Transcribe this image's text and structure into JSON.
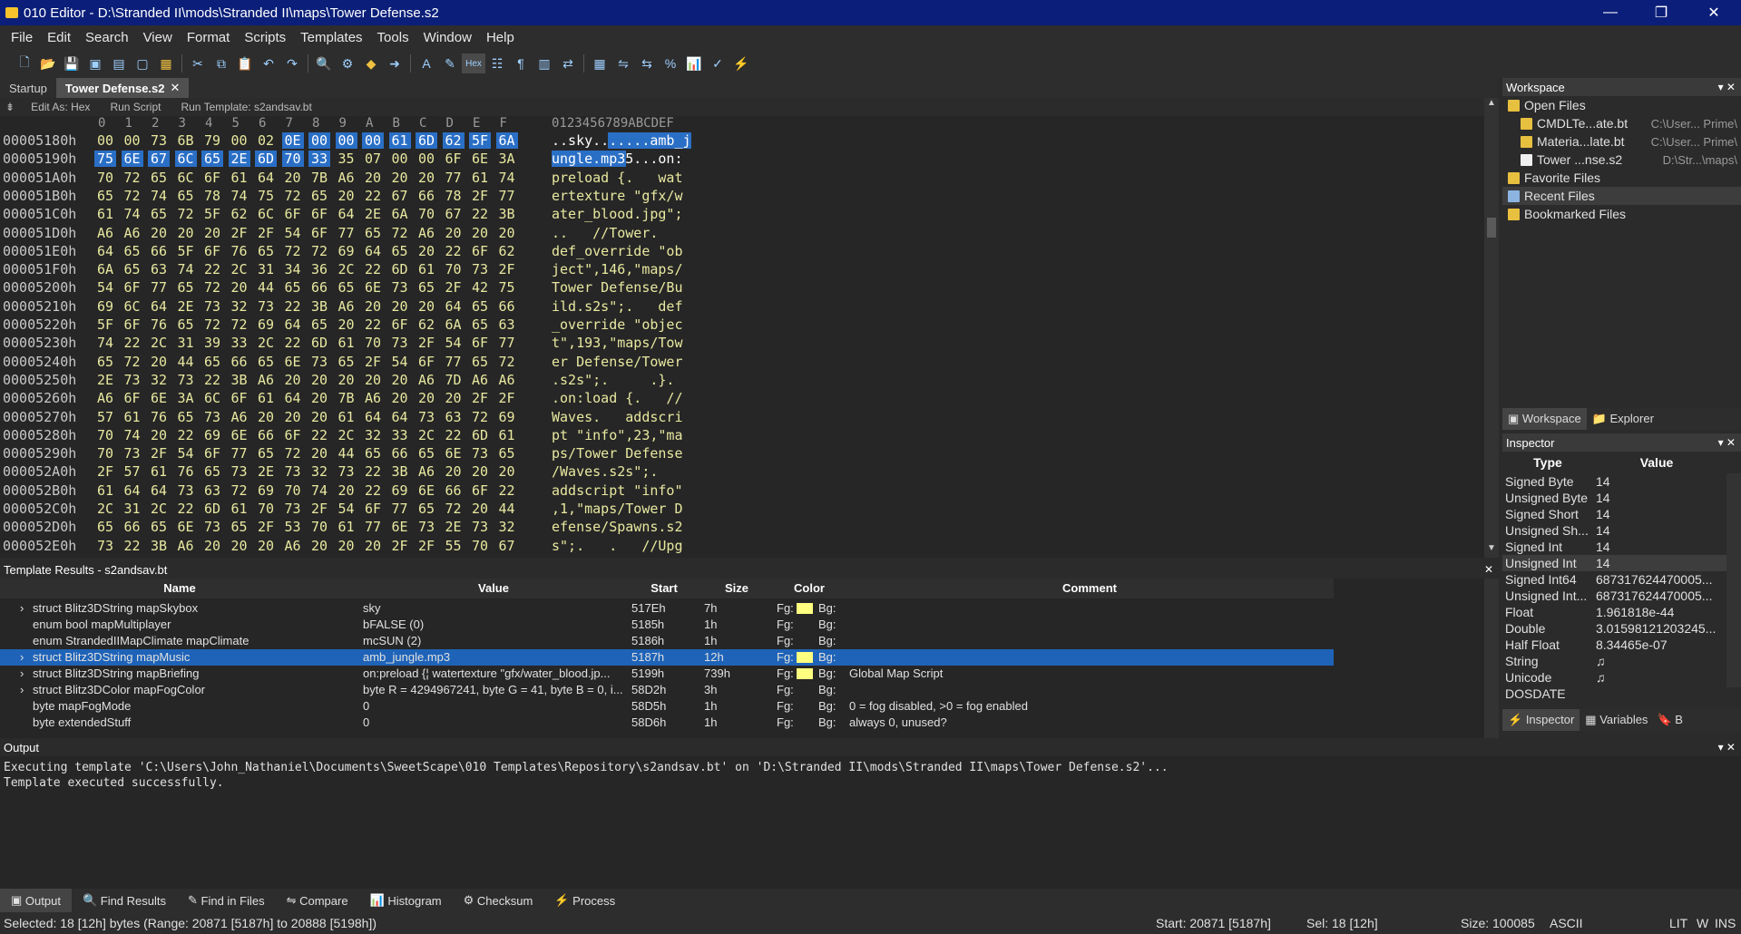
{
  "window": {
    "title": "010 Editor - D:\\Stranded II\\mods\\Stranded II\\maps\\Tower Defense.s2",
    "minimize": "—",
    "restore": "❐",
    "close": "✕"
  },
  "menu": [
    "File",
    "Edit",
    "Search",
    "View",
    "Format",
    "Scripts",
    "Templates",
    "Tools",
    "Window",
    "Help"
  ],
  "toolbar": {
    "hex_label": "Hex"
  },
  "tabs": {
    "startup": "Startup",
    "active": "Tower Defense.s2",
    "close": "✕"
  },
  "editbar": {
    "edit_as": "Edit As: Hex",
    "run_script": "Run Script",
    "run_template": "Run Template: s2andsav.bt"
  },
  "hex": {
    "col_headers": [
      "0",
      "1",
      "2",
      "3",
      "4",
      "5",
      "6",
      "7",
      "8",
      "9",
      "A",
      "B",
      "C",
      "D",
      "E",
      "F"
    ],
    "ascii_header": "0123456789ABCDEF",
    "rows": [
      {
        "addr": "00005180h",
        "bytes": [
          "00",
          "00",
          "73",
          "6B",
          "79",
          "00",
          "02",
          "0E",
          "00",
          "00",
          "00",
          "61",
          "6D",
          "62",
          "5F",
          "6A"
        ],
        "ascii": "..sky.......amb_j"
      },
      {
        "addr": "00005190h",
        "bytes": [
          "75",
          "6E",
          "67",
          "6C",
          "65",
          "2E",
          "6D",
          "70",
          "33",
          "35",
          "07",
          "00",
          "00",
          "6F",
          "6E",
          "3A"
        ],
        "ascii": "ungle.mp35...on:"
      },
      {
        "addr": "000051A0h",
        "bytes": [
          "70",
          "72",
          "65",
          "6C",
          "6F",
          "61",
          "64",
          "20",
          "7B",
          "A6",
          "20",
          "20",
          "20",
          "77",
          "61",
          "74"
        ],
        "ascii": "preload {.   wat"
      },
      {
        "addr": "000051B0h",
        "bytes": [
          "65",
          "72",
          "74",
          "65",
          "78",
          "74",
          "75",
          "72",
          "65",
          "20",
          "22",
          "67",
          "66",
          "78",
          "2F",
          "77"
        ],
        "ascii": "ertexture \"gfx/w"
      },
      {
        "addr": "000051C0h",
        "bytes": [
          "61",
          "74",
          "65",
          "72",
          "5F",
          "62",
          "6C",
          "6F",
          "6F",
          "64",
          "2E",
          "6A",
          "70",
          "67",
          "22",
          "3B"
        ],
        "ascii": "ater_blood.jpg\";"
      },
      {
        "addr": "000051D0h",
        "bytes": [
          "A6",
          "A6",
          "20",
          "20",
          "20",
          "2F",
          "2F",
          "54",
          "6F",
          "77",
          "65",
          "72",
          "A6",
          "20",
          "20",
          "20"
        ],
        "ascii": "..   //Tower.   "
      },
      {
        "addr": "000051E0h",
        "bytes": [
          "64",
          "65",
          "66",
          "5F",
          "6F",
          "76",
          "65",
          "72",
          "72",
          "69",
          "64",
          "65",
          "20",
          "22",
          "6F",
          "62"
        ],
        "ascii": "def_override \"ob"
      },
      {
        "addr": "000051F0h",
        "bytes": [
          "6A",
          "65",
          "63",
          "74",
          "22",
          "2C",
          "31",
          "34",
          "36",
          "2C",
          "22",
          "6D",
          "61",
          "70",
          "73",
          "2F"
        ],
        "ascii": "ject\",146,\"maps/"
      },
      {
        "addr": "00005200h",
        "bytes": [
          "54",
          "6F",
          "77",
          "65",
          "72",
          "20",
          "44",
          "65",
          "66",
          "65",
          "6E",
          "73",
          "65",
          "2F",
          "42",
          "75"
        ],
        "ascii": "Tower Defense/Bu"
      },
      {
        "addr": "00005210h",
        "bytes": [
          "69",
          "6C",
          "64",
          "2E",
          "73",
          "32",
          "73",
          "22",
          "3B",
          "A6",
          "20",
          "20",
          "20",
          "64",
          "65",
          "66"
        ],
        "ascii": "ild.s2s\";.   def"
      },
      {
        "addr": "00005220h",
        "bytes": [
          "5F",
          "6F",
          "76",
          "65",
          "72",
          "72",
          "69",
          "64",
          "65",
          "20",
          "22",
          "6F",
          "62",
          "6A",
          "65",
          "63"
        ],
        "ascii": "_override \"objec"
      },
      {
        "addr": "00005230h",
        "bytes": [
          "74",
          "22",
          "2C",
          "31",
          "39",
          "33",
          "2C",
          "22",
          "6D",
          "61",
          "70",
          "73",
          "2F",
          "54",
          "6F",
          "77"
        ],
        "ascii": "t\",193,\"maps/Tow"
      },
      {
        "addr": "00005240h",
        "bytes": [
          "65",
          "72",
          "20",
          "44",
          "65",
          "66",
          "65",
          "6E",
          "73",
          "65",
          "2F",
          "54",
          "6F",
          "77",
          "65",
          "72"
        ],
        "ascii": "er Defense/Tower"
      },
      {
        "addr": "00005250h",
        "bytes": [
          "2E",
          "73",
          "32",
          "73",
          "22",
          "3B",
          "A6",
          "20",
          "20",
          "20",
          "20",
          "20",
          "A6",
          "7D",
          "A6",
          "A6"
        ],
        "ascii": ".s2s\";.     .}."
      },
      {
        "addr": "00005260h",
        "bytes": [
          "A6",
          "6F",
          "6E",
          "3A",
          "6C",
          "6F",
          "61",
          "64",
          "20",
          "7B",
          "A6",
          "20",
          "20",
          "20",
          "2F",
          "2F"
        ],
        "ascii": ".on:load {.   //"
      },
      {
        "addr": "00005270h",
        "bytes": [
          "57",
          "61",
          "76",
          "65",
          "73",
          "A6",
          "20",
          "20",
          "20",
          "61",
          "64",
          "64",
          "73",
          "63",
          "72",
          "69"
        ],
        "ascii": "Waves.   addscri"
      },
      {
        "addr": "00005280h",
        "bytes": [
          "70",
          "74",
          "20",
          "22",
          "69",
          "6E",
          "66",
          "6F",
          "22",
          "2C",
          "32",
          "33",
          "2C",
          "22",
          "6D",
          "61"
        ],
        "ascii": "pt \"info\",23,\"ma"
      },
      {
        "addr": "00005290h",
        "bytes": [
          "70",
          "73",
          "2F",
          "54",
          "6F",
          "77",
          "65",
          "72",
          "20",
          "44",
          "65",
          "66",
          "65",
          "6E",
          "73",
          "65"
        ],
        "ascii": "ps/Tower Defense"
      },
      {
        "addr": "000052A0h",
        "bytes": [
          "2F",
          "57",
          "61",
          "76",
          "65",
          "73",
          "2E",
          "73",
          "32",
          "73",
          "22",
          "3B",
          "A6",
          "20",
          "20",
          "20"
        ],
        "ascii": "/Waves.s2s\";.   "
      },
      {
        "addr": "000052B0h",
        "bytes": [
          "61",
          "64",
          "64",
          "73",
          "63",
          "72",
          "69",
          "70",
          "74",
          "20",
          "22",
          "69",
          "6E",
          "66",
          "6F",
          "22"
        ],
        "ascii": "addscript \"info\""
      },
      {
        "addr": "000052C0h",
        "bytes": [
          "2C",
          "31",
          "2C",
          "22",
          "6D",
          "61",
          "70",
          "73",
          "2F",
          "54",
          "6F",
          "77",
          "65",
          "72",
          "20",
          "44"
        ],
        "ascii": ",1,\"maps/Tower D"
      },
      {
        "addr": "000052D0h",
        "bytes": [
          "65",
          "66",
          "65",
          "6E",
          "73",
          "65",
          "2F",
          "53",
          "70",
          "61",
          "77",
          "6E",
          "73",
          "2E",
          "73",
          "32"
        ],
        "ascii": "efense/Spawns.s2"
      },
      {
        "addr": "000052E0h",
        "bytes": [
          "73",
          "22",
          "3B",
          "A6",
          "20",
          "20",
          "20",
          "A6",
          "20",
          "20",
          "20",
          "2F",
          "2F",
          "55",
          "70",
          "67"
        ],
        "ascii": "s\";.   .   //Upg"
      },
      {
        "addr": "000052F0h",
        "bytes": [
          "72",
          "61",
          "64",
          "65",
          "20",
          "48",
          "61",
          "6E",
          "64",
          "6C",
          "65",
          "72",
          "A6",
          "20",
          "20",
          "20"
        ],
        "ascii": "rade Handler.   "
      }
    ]
  },
  "workspace": {
    "title": "Workspace",
    "open_files": "Open Files",
    "files": [
      {
        "name": "CMDLTe...ate.bt",
        "path": "C:\\User... Prime\\"
      },
      {
        "name": "Materia...late.bt",
        "path": "C:\\User... Prime\\"
      },
      {
        "name": "Tower ...nse.s2",
        "path": "D:\\Str...\\maps\\"
      }
    ],
    "favorite": "Favorite Files",
    "recent": "Recent Files",
    "bookmarked": "Bookmarked Files",
    "tab_workspace": "Workspace",
    "tab_explorer": "Explorer"
  },
  "inspector": {
    "title": "Inspector",
    "col_type": "Type",
    "col_value": "Value",
    "rows": [
      {
        "type": "Signed Byte",
        "value": "14"
      },
      {
        "type": "Unsigned Byte",
        "value": "14"
      },
      {
        "type": "Signed Short",
        "value": "14"
      },
      {
        "type": "Unsigned Sh...",
        "value": "14"
      },
      {
        "type": "Signed Int",
        "value": "14"
      },
      {
        "type": "Unsigned Int",
        "value": "14"
      },
      {
        "type": "Signed Int64",
        "value": "687317624470005..."
      },
      {
        "type": "Unsigned Int...",
        "value": "687317624470005..."
      },
      {
        "type": "Float",
        "value": "1.961818e-44"
      },
      {
        "type": "Double",
        "value": "3.01598121203245..."
      },
      {
        "type": "Half Float",
        "value": "8.34465e-07"
      },
      {
        "type": "String",
        "value": "♫"
      },
      {
        "type": "Unicode",
        "value": "♫"
      },
      {
        "type": "DOSDATE",
        "value": ""
      }
    ],
    "tab_inspector": "Inspector",
    "tab_variables": "Variables",
    "tab_b": "B"
  },
  "template": {
    "title": "Template Results - s2andsav.bt",
    "cols": [
      "Name",
      "Value",
      "Start",
      "Size",
      "Color",
      "Comment"
    ],
    "rows": [
      {
        "name": "struct Blitz3DString mapSkybox",
        "value": "sky",
        "start": "517Eh",
        "size": "7h",
        "fg": "Fg:",
        "bg": "Bg:",
        "comment": "",
        "arrow": true,
        "swatch": true
      },
      {
        "name": "enum bool mapMultiplayer",
        "value": "bFALSE (0)",
        "start": "5185h",
        "size": "1h",
        "fg": "Fg:",
        "bg": "Bg:",
        "comment": "",
        "arrow": false,
        "swatch": false
      },
      {
        "name": "enum StrandedIIMapClimate mapClimate",
        "value": "mcSUN (2)",
        "start": "5186h",
        "size": "1h",
        "fg": "Fg:",
        "bg": "Bg:",
        "comment": "",
        "arrow": false,
        "swatch": false
      },
      {
        "name": "struct Blitz3DString mapMusic",
        "value": "amb_jungle.mp3",
        "start": "5187h",
        "size": "12h",
        "fg": "Fg:",
        "bg": "Bg:",
        "comment": "",
        "arrow": true,
        "swatch": true
      },
      {
        "name": "struct Blitz3DString mapBriefing",
        "value": "on:preload {¦   watertexture \"gfx/water_blood.jp...",
        "start": "5199h",
        "size": "739h",
        "fg": "Fg:",
        "bg": "Bg:",
        "comment": "Global Map Script",
        "arrow": true,
        "swatch": true
      },
      {
        "name": "struct Blitz3DColor mapFogColor",
        "value": "byte R = 4294967241, byte G = 41, byte B = 0, i...",
        "start": "58D2h",
        "size": "3h",
        "fg": "Fg:",
        "bg": "Bg:",
        "comment": "",
        "arrow": true,
        "swatch": false
      },
      {
        "name": "byte mapFogMode",
        "value": "0",
        "start": "58D5h",
        "size": "1h",
        "fg": "Fg:",
        "bg": "Bg:",
        "comment": "0 = fog disabled, >0 = fog enabled",
        "arrow": false,
        "swatch": false
      },
      {
        "name": "byte extendedStuff",
        "value": "0",
        "start": "58D6h",
        "size": "1h",
        "fg": "Fg:",
        "bg": "Bg:",
        "comment": "always 0, unused?",
        "arrow": false,
        "swatch": false
      }
    ]
  },
  "output": {
    "title": "Output",
    "lines": [
      "Executing template 'C:\\Users\\John_Nathaniel\\Documents\\SweetScape\\010 Templates\\Repository\\s2andsav.bt' on 'D:\\Stranded II\\mods\\Stranded II\\maps\\Tower Defense.s2'...",
      "Template executed successfully."
    ]
  },
  "bottom_tabs": [
    "Output",
    "Find Results",
    "Find in Files",
    "Compare",
    "Histogram",
    "Checksum",
    "Process"
  ],
  "status": {
    "selected": "Selected: 18 [12h] bytes (Range: 20871 [5187h] to 20888 [5198h])",
    "start": "Start: 20871 [5187h]",
    "sel": "Sel: 18 [12h]",
    "size": "Size: 100085",
    "enc": "ASCII",
    "lit": "LIT",
    "w": "W",
    "ins": "INS"
  },
  "colors": {
    "titlebar": "#0b1f7a",
    "selection": "#2a6fc6",
    "hex_text": "#e8e8a0"
  }
}
